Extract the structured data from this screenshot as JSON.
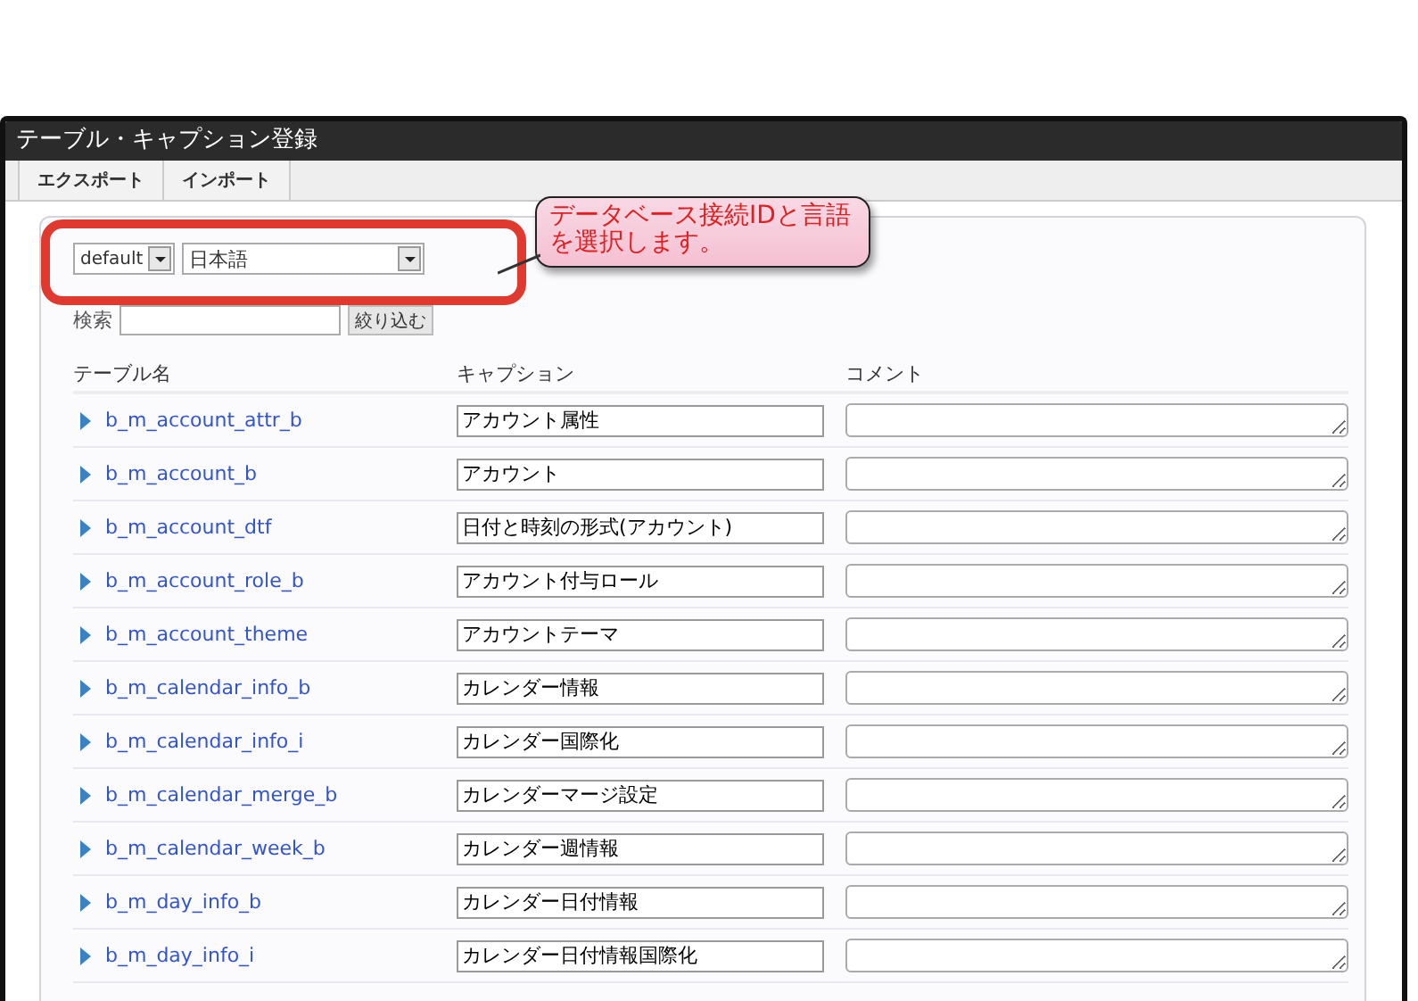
{
  "window": {
    "title": "テーブル・キャプション登録"
  },
  "toolbar": {
    "buttons": [
      "エクスポート",
      "インポート"
    ]
  },
  "connection_select": {
    "value": "default"
  },
  "language_select": {
    "value": "日本語"
  },
  "search": {
    "label": "検索",
    "button": "絞り込む"
  },
  "table": {
    "columns": [
      "テーブル名",
      "キャプション",
      "コメント"
    ],
    "rows": [
      {
        "name": "b_m_account_attr_b",
        "caption": "アカウント属性"
      },
      {
        "name": "b_m_account_b",
        "caption": "アカウント"
      },
      {
        "name": "b_m_account_dtf",
        "caption": "日付と時刻の形式(アカウント)"
      },
      {
        "name": "b_m_account_role_b",
        "caption": "アカウント付与ロール"
      },
      {
        "name": "b_m_account_theme",
        "caption": "アカウントテーマ"
      },
      {
        "name": "b_m_calendar_info_b",
        "caption": "カレンダー情報"
      },
      {
        "name": "b_m_calendar_info_i",
        "caption": "カレンダー国際化"
      },
      {
        "name": "b_m_calendar_merge_b",
        "caption": "カレンダーマージ設定"
      },
      {
        "name": "b_m_calendar_week_b",
        "caption": "カレンダー週情報"
      },
      {
        "name": "b_m_day_info_b",
        "caption": "カレンダー日付情報"
      },
      {
        "name": "b_m_day_info_i",
        "caption": "カレンダー日付情報国際化"
      }
    ]
  },
  "annotation": {
    "text": "データベース接続IDと言語を選択します。"
  }
}
